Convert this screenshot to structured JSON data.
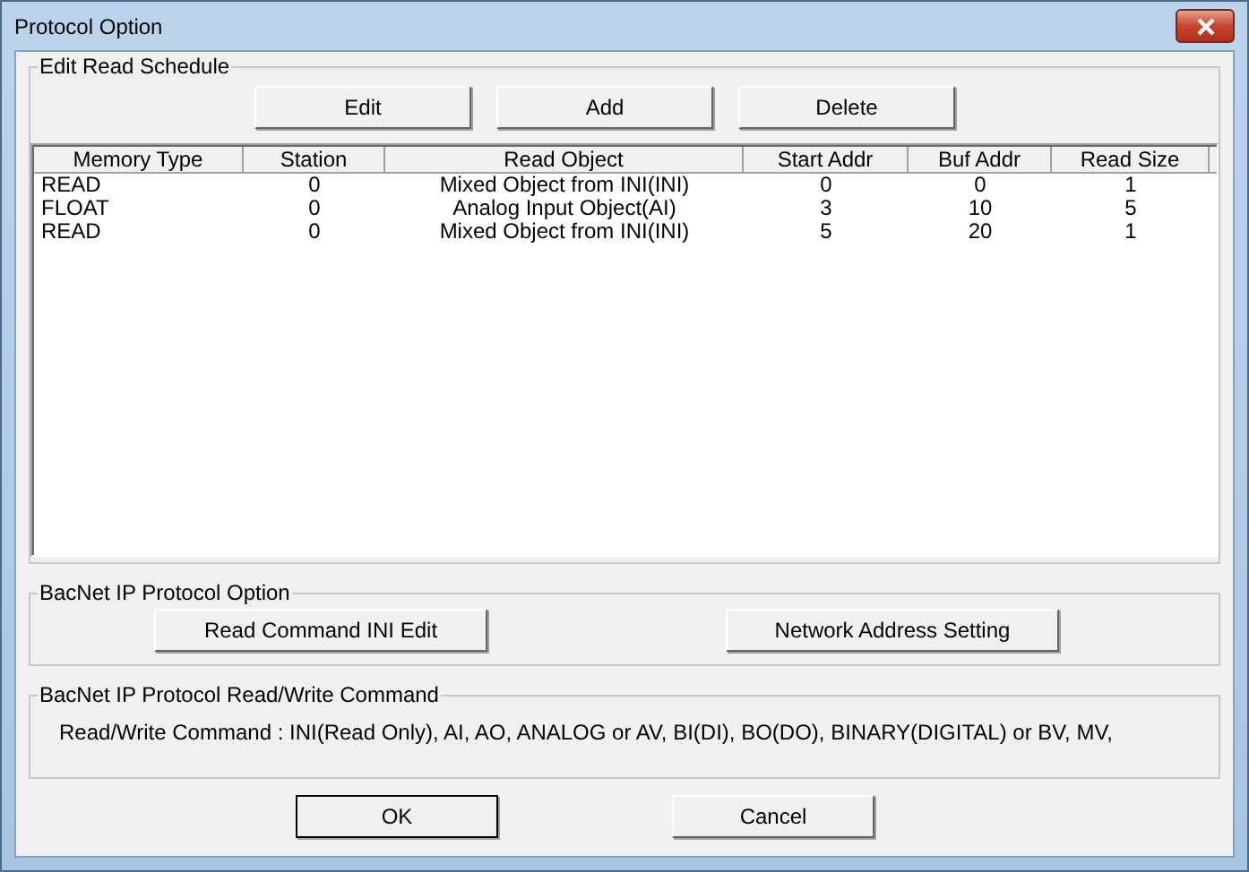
{
  "window": {
    "title": "Protocol Option"
  },
  "schedule": {
    "legend": "Edit Read Schedule",
    "buttons": [
      "Edit",
      "Add",
      "Delete"
    ],
    "columns": [
      "Memory Type",
      "Station",
      "Read Object",
      "Start Addr",
      "Buf Addr",
      "Read Size"
    ],
    "rows": [
      [
        "READ",
        "0",
        "Mixed Object from INI(INI)",
        "0",
        "0",
        "1"
      ],
      [
        "FLOAT",
        "0",
        "Analog Input Object(AI)",
        "3",
        "10",
        "5"
      ],
      [
        "READ",
        "0",
        "Mixed Object from INI(INI)",
        "5",
        "20",
        "1"
      ]
    ]
  },
  "option": {
    "legend": "BacNet IP Protocol Option",
    "buttons": [
      "Read Command INI Edit",
      "Network Address Setting"
    ]
  },
  "command": {
    "legend": "BacNet IP Protocol Read/Write Command",
    "text": "Read/Write Command : INI(Read Only), AI, AO, ANALOG or AV, BI(DI), BO(DO), BINARY(DIGITAL) or BV, MV,"
  },
  "footer_buttons": [
    "OK",
    "Cancel"
  ]
}
